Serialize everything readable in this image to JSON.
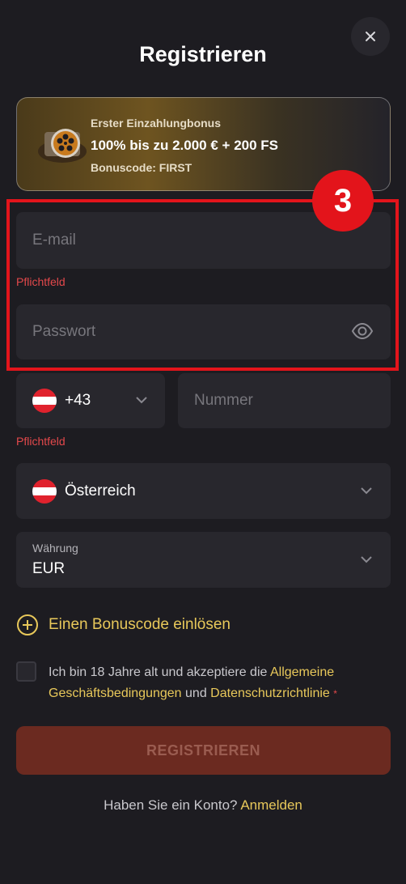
{
  "header": {
    "title": "Registrieren",
    "close_icon": "close-icon"
  },
  "bonus": {
    "subtitle": "Erster Einzahlungbonus",
    "main": "100% bis zu 2.000 € + 200 FS",
    "code": "Bonuscode: FIRST",
    "icon": "film-reel-icon"
  },
  "step_badge": "3",
  "email": {
    "placeholder": "E-mail",
    "error": "Pflichtfeld"
  },
  "password": {
    "placeholder": "Passwort",
    "icon": "eye-icon"
  },
  "phone": {
    "code": "+43",
    "placeholder": "Nummer",
    "error": "Pflichtfeld",
    "flag": "austria-flag"
  },
  "country": {
    "value": "Österreich",
    "flag": "austria-flag"
  },
  "currency": {
    "label": "Währung",
    "value": "EUR"
  },
  "bonus_code_link": "Einen Bonuscode einlösen",
  "terms": {
    "text_before": "Ich bin 18 Jahre alt und akzeptiere die ",
    "link1": "Allgemeine Geschäftsbedingungen",
    "text_middle": " und ",
    "link2": "Datenschutzrichtlinie",
    "required_mark": "*"
  },
  "submit_label": "REGISTRIEREN",
  "login": {
    "text": "Haben Sie ein Konto?",
    "link": "Anmelden"
  },
  "colors": {
    "accent": "#e8c85a",
    "error": "#e3484b",
    "highlight": "#e3141b",
    "button": "#6b2a20"
  }
}
